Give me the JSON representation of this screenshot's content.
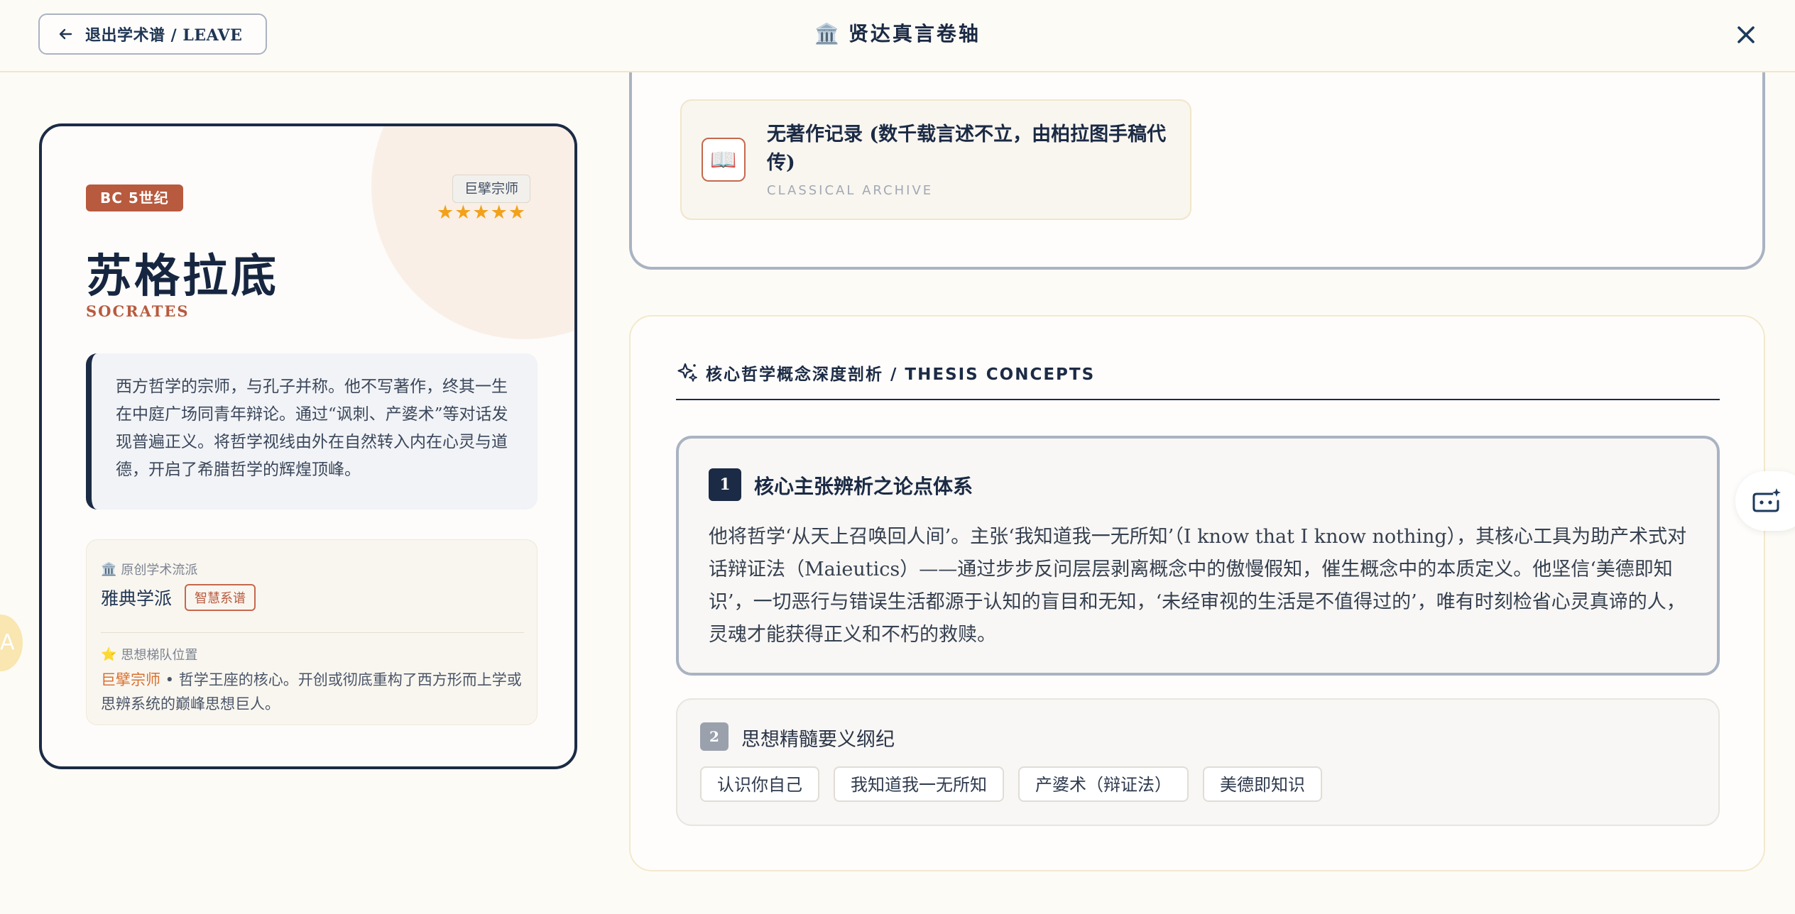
{
  "header": {
    "leave_label": "退出学术谱 / LEAVE",
    "title": "贤达真言卷轴",
    "title_icon": "🏛️"
  },
  "profile": {
    "era": "BC 5世纪",
    "rank": "巨擘宗师",
    "stars": "★★★★★",
    "rating": 5,
    "name_cn": "苏格拉底",
    "name_en": "SOCRATES",
    "bio": "西方哲学的宗师，与孔子并称。他不写著作，终其一生在中庭广场同青年辩论。通过“讽刺、产婆术”等对话发现普遍正义。将哲学视线由外在自然转入内在心灵与道德，开启了希腊哲学的辉煌顶峰。",
    "school_label": "原创学术流派",
    "school_icon": "🏛️",
    "school_name": "雅典学派",
    "school_tag": "智慧系谱",
    "tier_label": "思想梯队位置",
    "tier_icon": "⭐",
    "tier_name": "巨擘宗师",
    "tier_desc": " • 哲学王座的核心。开创或彻底重构了西方形而上学或思辨系统的巅峰思想巨人。"
  },
  "side_float_letter": "A",
  "works": {
    "icon": "📖",
    "title": "无著作记录 (数千载言述不立，由柏拉图手稿代传)",
    "subtitle": "CLASSICAL ARCHIVE"
  },
  "thesis": {
    "heading": "核心哲学概念深度剖析 / THESIS CONCEPTS",
    "concept1": {
      "number": "1",
      "title": "核心主张辨析之论点体系",
      "body": "他将哲学‘从天上召唤回人间’。主张‘我知道我一无所知’（I know that I know nothing），其核心工具为助产术式对话辩证法（Maieutics）——通过步步反问层层剥离概念中的傲慢假知，催生概念中的本质定义。他坚信‘美德即知识’，一切恶行与错误生活都源于认知的盲目和无知，‘未经审视的生活是不值得过的’，唯有时刻检省心灵真谛的人，灵魂才能获得正义和不朽的救赎。"
    },
    "concept2": {
      "number": "2",
      "title": "思想精髓要义纲纪",
      "keywords": [
        "认识你自己",
        "我知道我一无所知",
        "产婆术（辩证法）",
        "美德即知识"
      ]
    }
  },
  "colors": {
    "navy": "#1c2b45",
    "accent": "#b85a3e",
    "star": "#f3a11a",
    "background": "#fdfbf6"
  }
}
